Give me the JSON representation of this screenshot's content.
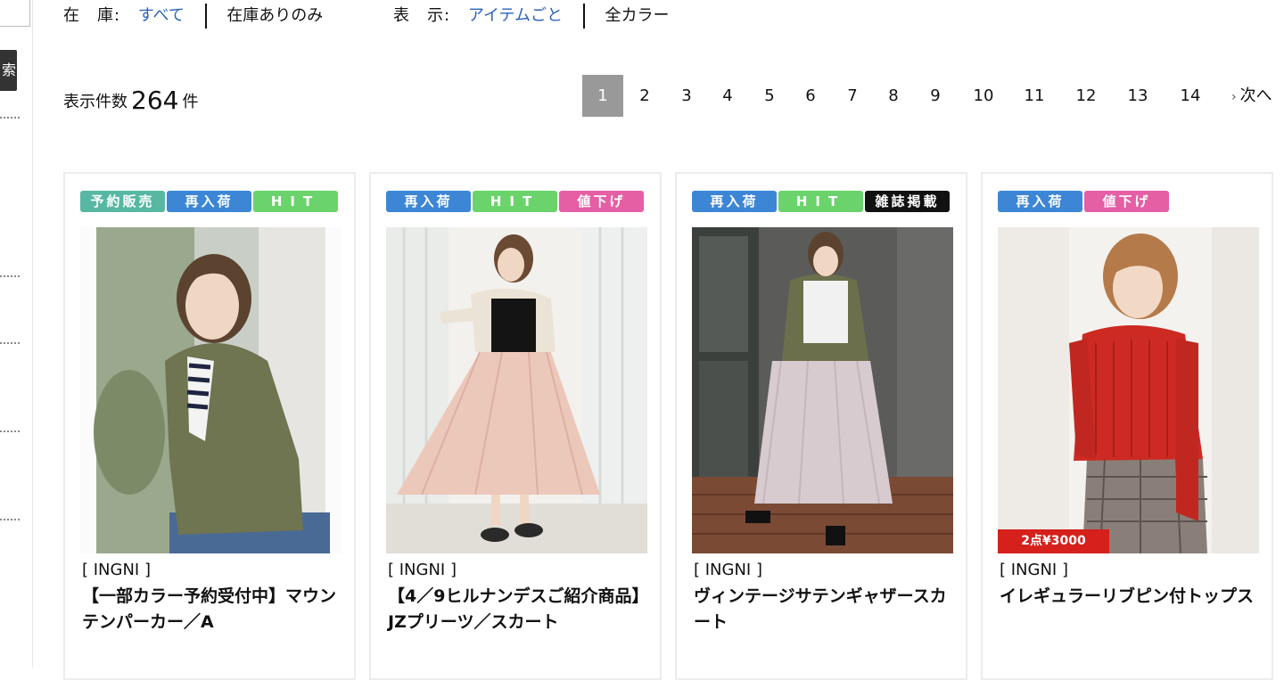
{
  "sidebar": {
    "search_glyph": "索"
  },
  "filters": {
    "stock": {
      "label": "在　庫:",
      "active": "すべて",
      "other": "在庫ありのみ"
    },
    "display": {
      "label": "表　示:",
      "active": "アイテムごと",
      "other": "全カラー"
    }
  },
  "count": {
    "prefix": "表示件数",
    "value": "264",
    "suffix": "件"
  },
  "pagination": {
    "current": "1",
    "pages": [
      "1",
      "2",
      "3",
      "4",
      "5",
      "6",
      "7",
      "8",
      "9",
      "10",
      "11",
      "12",
      "13",
      "14"
    ],
    "next_label": "次へ"
  },
  "badge_colors": {
    "予約販売": "#58b7a2",
    "再入荷": "#3d86d6",
    "HIT": "#6bd36b",
    "値下げ": "#e45fa4",
    "雑誌掲載": "#111111"
  },
  "products": [
    {
      "badges": [
        "予約販売",
        "再入荷",
        "HIT"
      ],
      "brand": "[ INGNI ]",
      "title": "【一部カラー予約受付中】マウンテンパーカー／A",
      "promo": ""
    },
    {
      "badges": [
        "再入荷",
        "HIT",
        "値下げ"
      ],
      "brand": "[ INGNI ]",
      "title": "【4／9ヒルナンデスご紹介商品】JZプリーツ／スカート",
      "promo": ""
    },
    {
      "badges": [
        "再入荷",
        "HIT",
        "雑誌掲載"
      ],
      "brand": "[ INGNI ]",
      "title": "ヴィンテージサテンギャザースカート",
      "promo": ""
    },
    {
      "badges": [
        "再入荷",
        "値下げ"
      ],
      "brand": "[ INGNI ]",
      "title": "イレギュラーリブピン付トップス",
      "promo": "2点¥3000"
    }
  ]
}
